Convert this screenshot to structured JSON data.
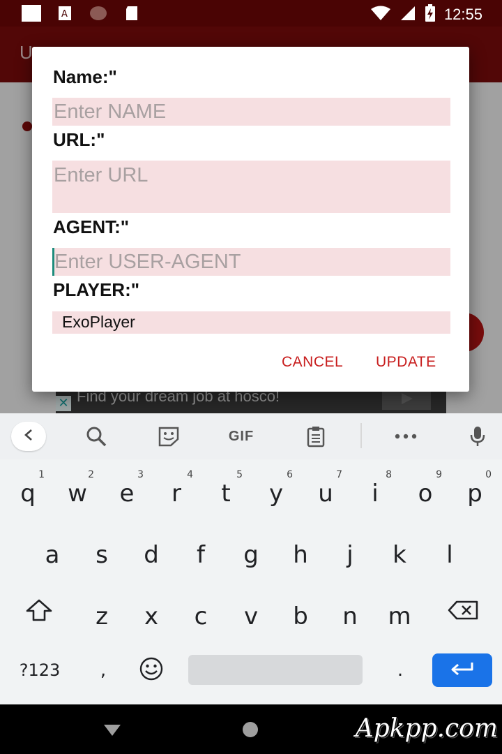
{
  "status_bar": {
    "time": "12:55",
    "left_icons": [
      "white-square-icon",
      "a-note-icon",
      "brown-circle-icon",
      "sd-card-icon"
    ],
    "right_icons": [
      "wifi-icon",
      "signal-icon",
      "battery-charging-icon"
    ]
  },
  "app_bar": {
    "title_fragment": "U"
  },
  "ad": {
    "close_glyph": "✕",
    "text": "Find your dream job at hosco!"
  },
  "dialog": {
    "fields": [
      {
        "label": "Name:\"",
        "placeholder": "Enter NAME",
        "value": ""
      },
      {
        "label": "URL:\"",
        "placeholder": "Enter URL",
        "value": ""
      },
      {
        "label": "AGENT:\"",
        "placeholder": "Enter USER-AGENT",
        "value": "",
        "focused": true
      },
      {
        "label": "PLAYER:\"",
        "selected": "ExoPlayer"
      }
    ],
    "cancel_label": "CANCEL",
    "update_label": "UPDATE",
    "accent_color": "#c81e1e"
  },
  "keyboard": {
    "toolbar": [
      "back-icon",
      "search-icon",
      "sticker-icon",
      "GIF",
      "clipboard-icon",
      "more-icon",
      "mic-icon"
    ],
    "gif_label": "GIF",
    "row1": [
      {
        "key": "q",
        "hint": "1"
      },
      {
        "key": "w",
        "hint": "2"
      },
      {
        "key": "e",
        "hint": "3"
      },
      {
        "key": "r",
        "hint": "4"
      },
      {
        "key": "t",
        "hint": "5"
      },
      {
        "key": "y",
        "hint": "6"
      },
      {
        "key": "u",
        "hint": "7"
      },
      {
        "key": "i",
        "hint": "8"
      },
      {
        "key": "o",
        "hint": "9"
      },
      {
        "key": "p",
        "hint": "0"
      }
    ],
    "row2": [
      "a",
      "s",
      "d",
      "f",
      "g",
      "h",
      "j",
      "k",
      "l"
    ],
    "row3": [
      "z",
      "x",
      "c",
      "v",
      "b",
      "n",
      "m"
    ],
    "symbols_label": "?123",
    "comma": ",",
    "period": ".",
    "enter_color": "#1a73e8"
  },
  "nav_bar": {
    "watermark": "Apkpp.com"
  }
}
